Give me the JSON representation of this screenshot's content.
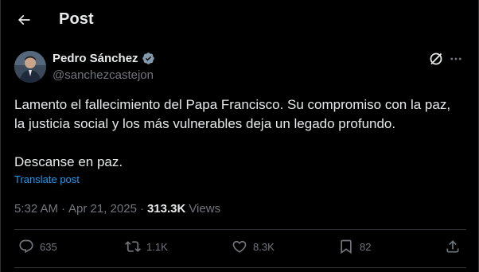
{
  "header": {
    "title": "Post"
  },
  "author": {
    "name": "Pedro Sánchez",
    "handle": "@sanchezcastejon"
  },
  "tweet": {
    "text": "Lamento el fallecimiento del Papa Francisco. Su compromiso con la paz,\nla justicia social y los más vulnerables deja un legado profundo.\n\nDescanse en paz.",
    "translate_label": "Translate post",
    "time": "5:32 AM",
    "date": "Apr 21, 2025",
    "separator": "·",
    "views_count": "313.3K",
    "views_label": "Views"
  },
  "actions": {
    "replies": "635",
    "reposts": "1.1K",
    "likes": "8.3K",
    "bookmarks": "82"
  },
  "colors": {
    "background": "#000000",
    "text": "#e7e9ea",
    "secondary": "#71767b",
    "link": "#1d9bf0",
    "border": "#2f3336"
  }
}
